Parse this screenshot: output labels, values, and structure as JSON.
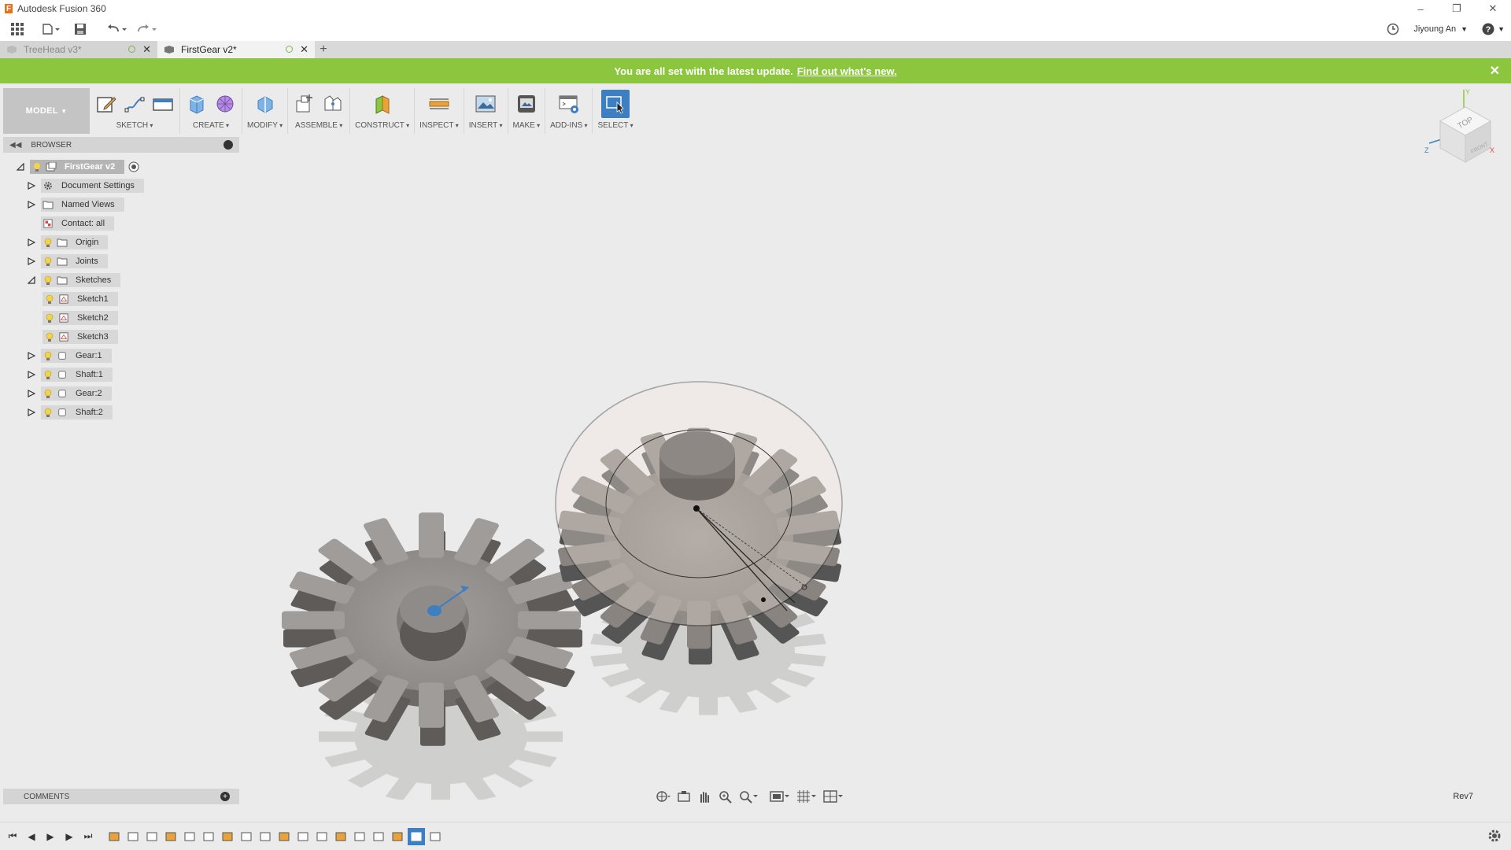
{
  "window": {
    "title": "Autodesk Fusion 360"
  },
  "user": {
    "name": "Jiyoung An"
  },
  "tabs": [
    {
      "label": "TreeHead v3*",
      "active": false
    },
    {
      "label": "FirstGear v2*",
      "active": true
    }
  ],
  "banner": {
    "message": "You are all set with the latest update.",
    "link": "Find out what's new."
  },
  "toolbar": {
    "workspace": "MODEL",
    "groups": [
      "SKETCH",
      "CREATE",
      "MODIFY",
      "ASSEMBLE",
      "CONSTRUCT",
      "INSPECT",
      "INSERT",
      "MAKE",
      "ADD-INS",
      "SELECT"
    ]
  },
  "browser": {
    "title": "BROWSER",
    "root": "FirstGear v2",
    "items": [
      {
        "label": "Document Settings",
        "icon": "gear-icon",
        "expander": "collapsed"
      },
      {
        "label": "Named Views",
        "icon": "folder-icon",
        "expander": "collapsed"
      },
      {
        "label": "Contact: all",
        "icon": "contact-icon",
        "expander": "none"
      },
      {
        "label": "Origin",
        "icon": "folder-icon",
        "expander": "collapsed"
      },
      {
        "label": "Joints",
        "icon": "folder-icon",
        "expander": "collapsed"
      },
      {
        "label": "Sketches",
        "icon": "folder-icon",
        "expander": "expanded"
      },
      {
        "label": "Sketch1",
        "icon": "sketch-icon",
        "expander": "none"
      },
      {
        "label": "Sketch2",
        "icon": "sketch-icon",
        "expander": "none"
      },
      {
        "label": "Sketch3",
        "icon": "sketch-icon",
        "expander": "none"
      },
      {
        "label": "Gear:1",
        "icon": "component-icon",
        "expander": "collapsed"
      },
      {
        "label": "Shaft:1",
        "icon": "component-icon",
        "expander": "collapsed"
      },
      {
        "label": "Gear:2",
        "icon": "component-icon",
        "expander": "collapsed"
      },
      {
        "label": "Shaft:2",
        "icon": "component-icon",
        "expander": "collapsed"
      }
    ]
  },
  "comments": {
    "title": "COMMENTS"
  },
  "viewcube": {
    "face": "TOP",
    "front": "FRONT"
  },
  "axes": {
    "x": "X",
    "y": "Y",
    "z": "Z"
  },
  "revision": "Rev7",
  "colors": {
    "banner": "#8cc63f",
    "accent": "#3e7fc1",
    "gear": "#8c8784"
  }
}
